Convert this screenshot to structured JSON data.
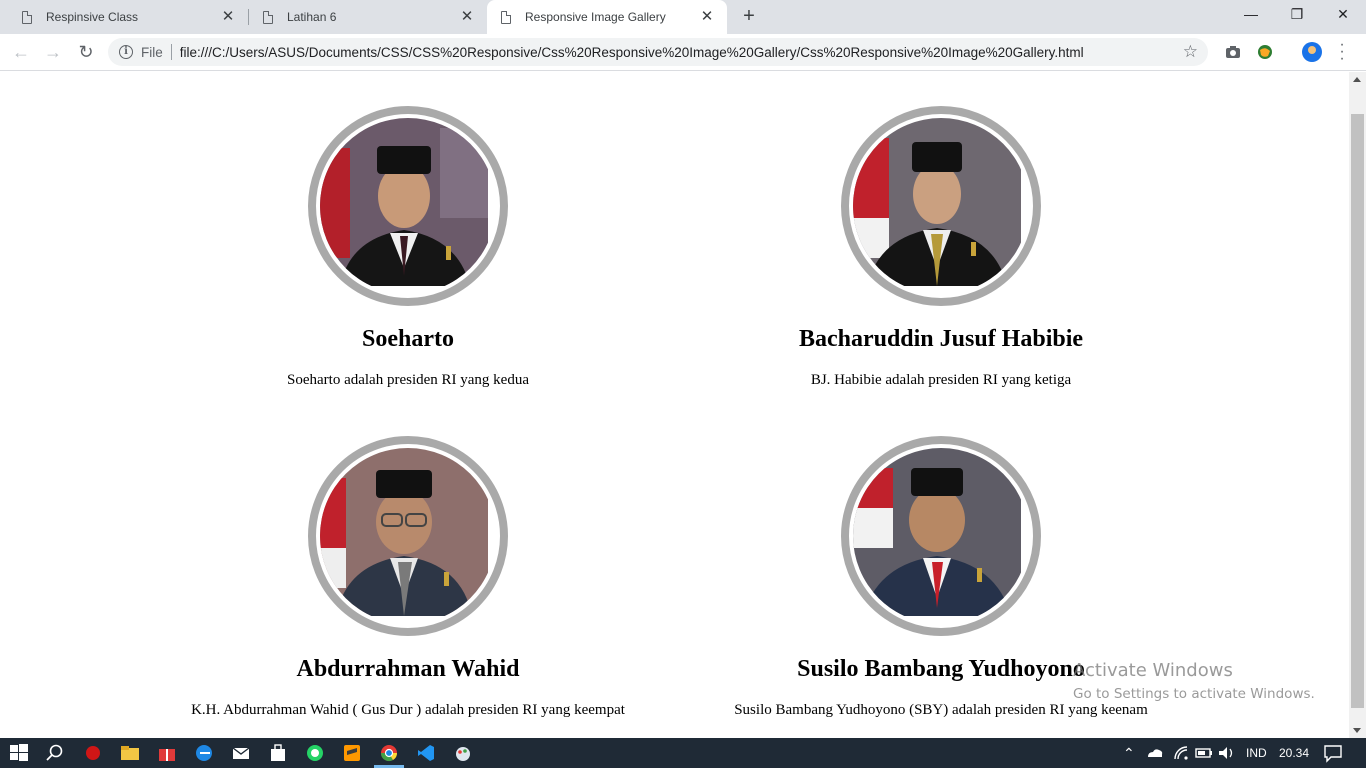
{
  "browser": {
    "tabs": [
      {
        "title": "Respinsive Class",
        "active": false
      },
      {
        "title": "Latihan 6",
        "active": false
      },
      {
        "title": "Responsive Image Gallery",
        "active": true
      }
    ],
    "address": {
      "scheme_label": "File",
      "url": "file:///C:/Users/ASUS/Documents/CSS/CSS%20Responsive/Css%20Responsive%20Image%20Gallery/Css%20Responsive%20Image%20Gallery.html"
    },
    "icons": {
      "back": "←",
      "forward": "→",
      "reload": "↻",
      "star": "☆",
      "new_tab": "+",
      "close": "✕",
      "minimize": "—",
      "restore": "❐",
      "window_close": "✕"
    }
  },
  "gallery": [
    {
      "name": "Soeharto",
      "description": "Soeharto adalah presiden RI yang kedua",
      "flag": true,
      "tie": "#3a1a22",
      "bg": "#6b5a6a"
    },
    {
      "name": "Bacharuddin Jusuf Habibie",
      "description": "BJ. Habibie adalah presiden RI yang ketiga",
      "flag": true,
      "tie": "#b59a3a",
      "bg": "#6e6870"
    },
    {
      "name": "Abdurrahman Wahid",
      "description": "K.H. Abdurrahman Wahid ( Gus Dur ) adalah presiden RI yang keempat",
      "flag": true,
      "tie": "#8b8b8b",
      "bg": "#8e6f6c"
    },
    {
      "name": "Susilo Bambang Yudhoyono",
      "description": "Susilo Bambang Yudhoyono (SBY) adalah presiden RI yang keenam",
      "flag": true,
      "tie": "#c8202a",
      "bg": "#5e5c66"
    }
  ],
  "watermark": {
    "line1": "Activate Windows",
    "line2": "Go to Settings to activate Windows."
  },
  "taskbar": {
    "language": "IND",
    "time": "20.34"
  },
  "colors": {
    "portrait_border": "#a9a9a9",
    "taskbar": "#1f2a36"
  }
}
